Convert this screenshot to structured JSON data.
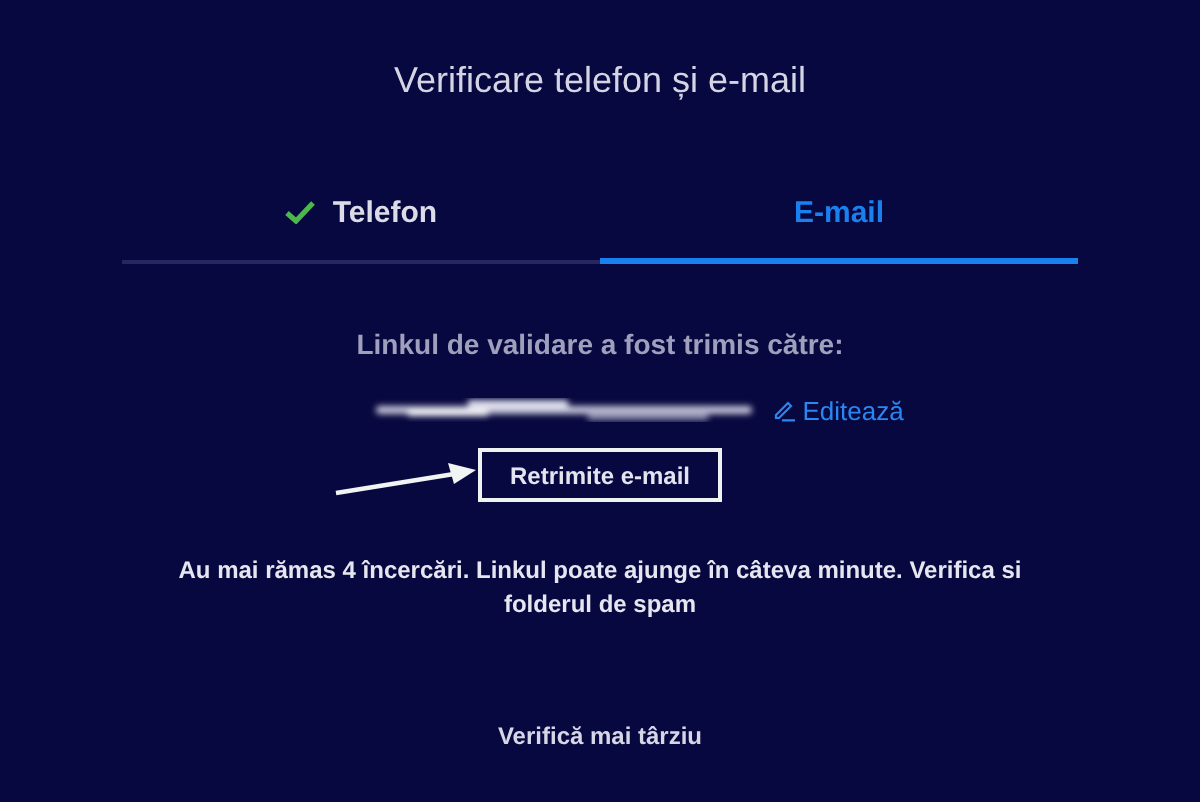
{
  "title": "Verificare telefon și e-mail",
  "tabs": [
    {
      "label": "Telefon",
      "selected": false,
      "done": true
    },
    {
      "label": "E-mail",
      "selected": true,
      "done": false
    }
  ],
  "sent_label": "Linkul de validare a fost trimis către:",
  "edit_link": "Editează",
  "resend_button": "Retrimite e-mail",
  "info": "Au mai rămas 4 încercări. Linkul poate ajunge în câteva minute. Verifica si folderul de spam",
  "later_link": "Verifică mai târziu"
}
